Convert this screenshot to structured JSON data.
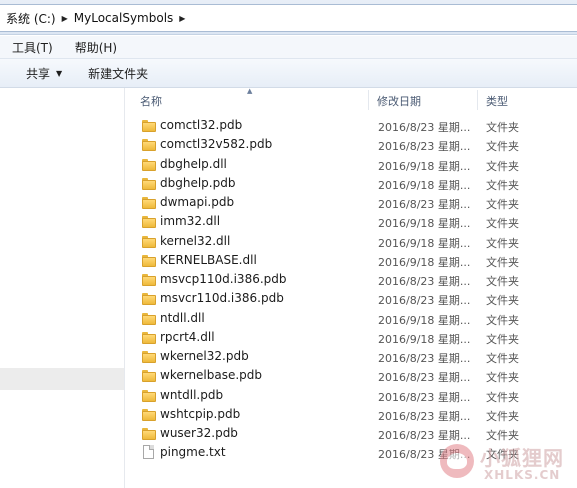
{
  "address_bar": {
    "crumbs": [
      "系统 (C:)",
      "MyLocalSymbols"
    ]
  },
  "menu": {
    "items": [
      "工具(T)",
      "帮助(H)"
    ]
  },
  "toolbar": {
    "share_label": "共享",
    "new_folder_label": "新建文件夹"
  },
  "columns": {
    "name": "名称",
    "date": "修改日期",
    "type": "类型"
  },
  "files": [
    {
      "name": "comctl32.pdb",
      "date": "2016/8/23 星期...",
      "type": "文件夹",
      "icon": "folder-icon"
    },
    {
      "name": "comctl32v582.pdb",
      "date": "2016/8/23 星期...",
      "type": "文件夹",
      "icon": "folder-icon"
    },
    {
      "name": "dbghelp.dll",
      "date": "2016/9/18 星期...",
      "type": "文件夹",
      "icon": "folder-icon"
    },
    {
      "name": "dbghelp.pdb",
      "date": "2016/9/18 星期...",
      "type": "文件夹",
      "icon": "folder-icon"
    },
    {
      "name": "dwmapi.pdb",
      "date": "2016/8/23 星期...",
      "type": "文件夹",
      "icon": "folder-icon"
    },
    {
      "name": "imm32.dll",
      "date": "2016/9/18 星期...",
      "type": "文件夹",
      "icon": "folder-icon"
    },
    {
      "name": "kernel32.dll",
      "date": "2016/9/18 星期...",
      "type": "文件夹",
      "icon": "folder-icon"
    },
    {
      "name": "KERNELBASE.dll",
      "date": "2016/9/18 星期...",
      "type": "文件夹",
      "icon": "folder-icon"
    },
    {
      "name": "msvcp110d.i386.pdb",
      "date": "2016/8/23 星期...",
      "type": "文件夹",
      "icon": "folder-icon"
    },
    {
      "name": "msvcr110d.i386.pdb",
      "date": "2016/8/23 星期...",
      "type": "文件夹",
      "icon": "folder-icon"
    },
    {
      "name": "ntdll.dll",
      "date": "2016/9/18 星期...",
      "type": "文件夹",
      "icon": "folder-icon"
    },
    {
      "name": "rpcrt4.dll",
      "date": "2016/9/18 星期...",
      "type": "文件夹",
      "icon": "folder-icon"
    },
    {
      "name": "wkernel32.pdb",
      "date": "2016/8/23 星期...",
      "type": "文件夹",
      "icon": "folder-icon"
    },
    {
      "name": "wkernelbase.pdb",
      "date": "2016/8/23 星期...",
      "type": "文件夹",
      "icon": "folder-icon"
    },
    {
      "name": "wntdll.pdb",
      "date": "2016/8/23 星期...",
      "type": "文件夹",
      "icon": "folder-icon"
    },
    {
      "name": "wshtcpip.pdb",
      "date": "2016/8/23 星期...",
      "type": "文件夹",
      "icon": "folder-icon"
    },
    {
      "name": "wuser32.pdb",
      "date": "2016/8/23 星期...",
      "type": "文件夹",
      "icon": "folder-icon"
    },
    {
      "name": "pingme.txt",
      "date": "2016/8/23 星期...",
      "type": "文件夹",
      "icon": "file-icon"
    }
  ],
  "watermark": {
    "cn": "小狐狸网",
    "en": "XHLKS.CN"
  },
  "colors": {
    "folder": "#f0bd45",
    "accent": "#dce6f3"
  }
}
